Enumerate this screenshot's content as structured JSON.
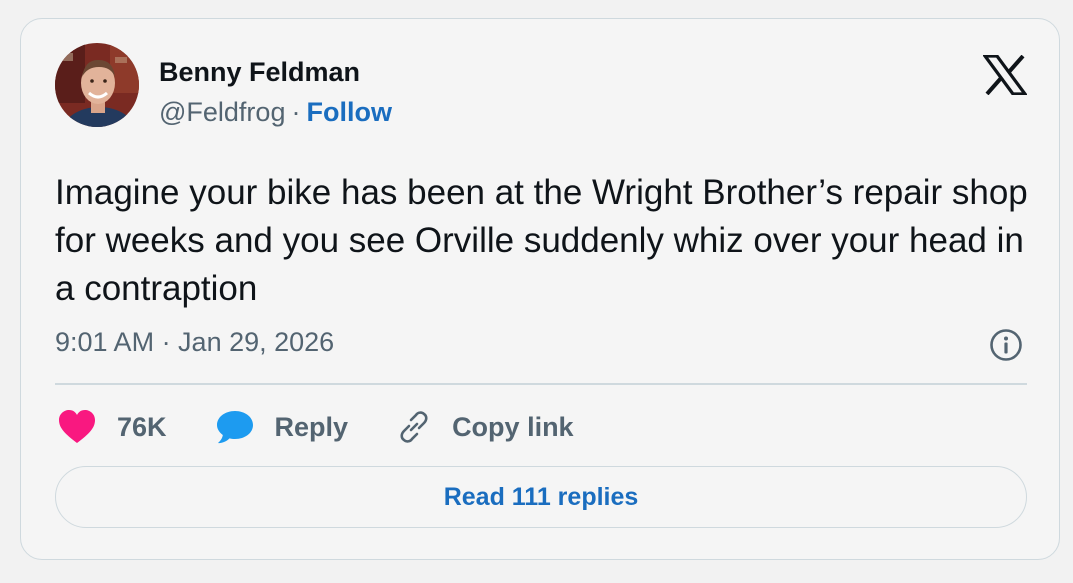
{
  "author": {
    "name": "Benny Feldman",
    "handle": "@Feldfrog",
    "separator": "·",
    "follow_label": "Follow"
  },
  "tweet": {
    "text": "Imagine your bike has been at the Wright Brother’s repair shop for weeks and you see Orville suddenly whiz over your head in a contraption",
    "timestamp": "9:01 AM · Jan 29, 2026"
  },
  "actions": {
    "like_count": "76K",
    "reply_label": "Reply",
    "copy_link_label": "Copy link"
  },
  "replies": {
    "button_label": "Read 111 replies"
  },
  "icons": {
    "logo": "x-logo-icon",
    "info": "info-icon",
    "like": "heart-icon",
    "reply": "speech-bubble-icon",
    "copy": "link-icon"
  },
  "colors": {
    "like": "#f91880",
    "reply": "#1d9bf0",
    "link_blue": "#1a6dbf",
    "muted": "#536471"
  }
}
